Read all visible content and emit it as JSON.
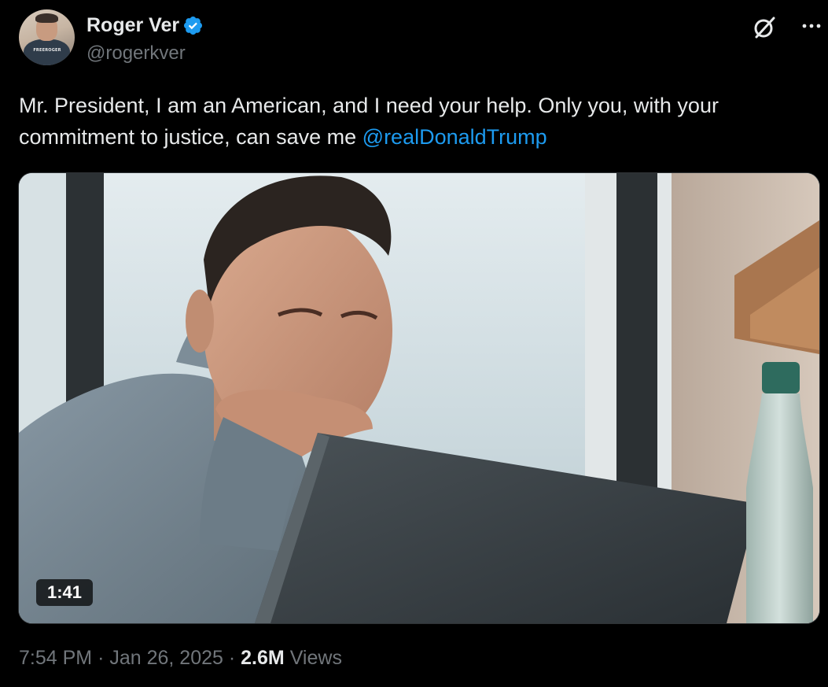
{
  "author": {
    "display_name": "Roger Ver",
    "handle": "@rogerkver",
    "verified": true,
    "avatar_shirt_text": "FREEROGER"
  },
  "tweet": {
    "text_main": "Mr. President, I am an American, and I need your help. Only you, with your commitment to justice, can save me ",
    "mention": "@realDonaldTrump"
  },
  "media": {
    "type": "video",
    "duration": "1:41"
  },
  "meta": {
    "time": "7:54 PM",
    "date": "Jan 26, 2025",
    "separator": "·",
    "views_count": "2.6M",
    "views_label": "Views"
  },
  "icons": {
    "verified": "verified-badge-icon",
    "grok": "grok-icon",
    "more": "more-options-icon"
  },
  "colors": {
    "background": "#000000",
    "text": "#e7e9ea",
    "secondary": "#71767b",
    "link": "#1d9bf0",
    "verified": "#1d9bf0"
  }
}
